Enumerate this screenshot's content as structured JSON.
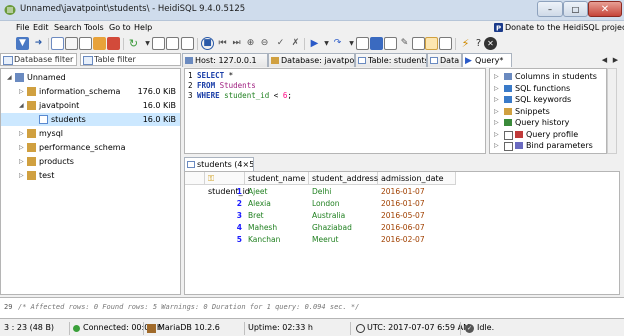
{
  "window": {
    "title": "Unnamed\\javatpoint\\students\\ - HeidiSQL 9.4.0.5125",
    "min_label": "–",
    "max_label": "□",
    "close_label": "✕"
  },
  "menu": [
    "File",
    "Edit",
    "Search",
    "Tools",
    "Go to",
    "Help"
  ],
  "donate_label": "Donate to the HeidiSQL project",
  "left_pane": {
    "database_filter_placeholder": "Database filter",
    "table_filter_placeholder": "Table filter",
    "tree": [
      {
        "label": "Unnamed",
        "size": "",
        "level": 0,
        "expanded": true,
        "selected": false,
        "icon": "server-icon"
      },
      {
        "label": "information_schema",
        "size": "176.0 KiB",
        "level": 1,
        "expanded": false,
        "selected": false,
        "icon": "database-icon"
      },
      {
        "label": "javatpoint",
        "size": "16.0 KiB",
        "level": 1,
        "expanded": true,
        "selected": false,
        "icon": "database-icon"
      },
      {
        "label": "students",
        "size": "16.0 KiB",
        "level": 2,
        "expanded": false,
        "selected": true,
        "icon": "table-icon"
      },
      {
        "label": "mysql",
        "size": "",
        "level": 1,
        "expanded": false,
        "selected": false,
        "icon": "database-icon"
      },
      {
        "label": "performance_schema",
        "size": "",
        "level": 1,
        "expanded": false,
        "selected": false,
        "icon": "database-icon"
      },
      {
        "label": "products",
        "size": "",
        "level": 1,
        "expanded": false,
        "selected": false,
        "icon": "database-icon"
      },
      {
        "label": "test",
        "size": "",
        "level": 1,
        "expanded": false,
        "selected": false,
        "icon": "database-icon"
      }
    ]
  },
  "tabs": [
    {
      "label": "Host: 127.0.0.1",
      "icon": "host-icon",
      "active": false
    },
    {
      "label": "Database: javatpoint",
      "icon": "database-icon",
      "active": false
    },
    {
      "label": "Table: students",
      "icon": "table-icon",
      "active": false
    },
    {
      "label": "Data",
      "icon": "data-icon",
      "active": false
    },
    {
      "label": "Query*",
      "icon": "play-icon",
      "active": true
    }
  ],
  "query": {
    "line_numbers": [
      "1",
      "2",
      "3"
    ],
    "line1_kw": "SELECT",
    "line1_rest": " *",
    "line2_kw": "FROM",
    "line2_table": "Students",
    "line3_kw": "WHERE",
    "line3_col": "student_id",
    "line3_op": " < ",
    "line3_num": "6",
    "line3_end": ";"
  },
  "helpers": [
    {
      "label": "Columns in students",
      "icon": "columns-icon",
      "checkbox": false
    },
    {
      "label": "SQL functions",
      "icon": "function-icon",
      "checkbox": false
    },
    {
      "label": "SQL keywords",
      "icon": "keyword-icon",
      "checkbox": false
    },
    {
      "label": "Snippets",
      "icon": "snippet-icon",
      "checkbox": false
    },
    {
      "label": "Query history",
      "icon": "history-icon",
      "checkbox": false
    },
    {
      "label": "Query profile",
      "icon": "profile-icon",
      "checkbox": true
    },
    {
      "label": "Bind parameters",
      "icon": "params-icon",
      "checkbox": true
    }
  ],
  "result_tab": "students (4×5)",
  "grid": {
    "columns": [
      "student_id",
      "student_name",
      "student_address",
      "admission_date"
    ],
    "rows": [
      [
        "1",
        "Ajeet",
        "Delhi",
        "2016-01-07"
      ],
      [
        "2",
        "Alexia",
        "London",
        "2016-01-07"
      ],
      [
        "3",
        "Bret",
        "Australia",
        "2016-05-07"
      ],
      [
        "4",
        "Mahesh",
        "Ghaziabad",
        "2016-06-07"
      ],
      [
        "5",
        "Kanchan",
        "Meerut",
        "2016-02-07"
      ]
    ]
  },
  "log": {
    "line_no": "29",
    "text": "/* Affected rows: 0  Found rows: 5  Warnings: 0  Duration for 1 query: 0.094 sec. */"
  },
  "status": {
    "position": "3 : 23 (48 B)",
    "connected": "Connected: 00:01 h",
    "server": "MariaDB 10.2.6",
    "uptime": "Uptime: 02:33 h",
    "utc": "UTC: 2017-07-07 6:59 AM",
    "state": "Idle."
  },
  "colors": {
    "selection": "#cce8ff",
    "keyword": "#1a3ea8",
    "number": "#1a1aff",
    "string": "#208020",
    "date": "#a04000"
  }
}
